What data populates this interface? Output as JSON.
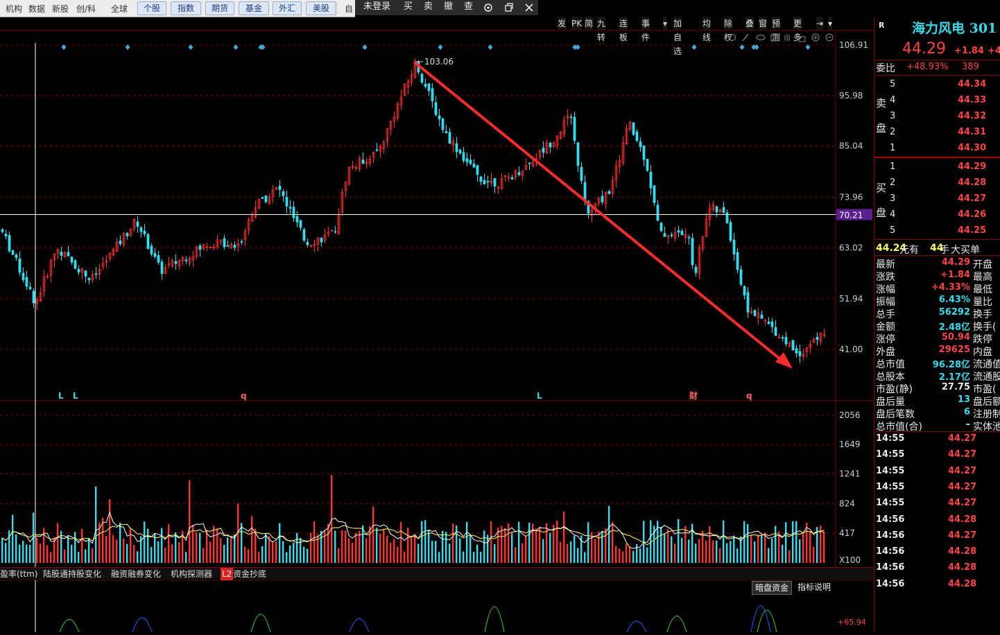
{
  "topbar": {
    "items": [
      "机构",
      "数据",
      "新股",
      "创/科",
      "全球"
    ],
    "buttons": [
      "个股",
      "指数",
      "期货",
      "基金",
      "外汇",
      "美股"
    ],
    "cut": "自"
  },
  "trade": {
    "login": "未登录",
    "buy": "买",
    "sell": "卖",
    "cancel": "撤",
    "query": "查"
  },
  "toolbar": [
    "发",
    "PK",
    "简",
    "九转",
    "连板",
    "事件",
    "加自选",
    "均线",
    "除权",
    "叠",
    "窗",
    "预测",
    "更多"
  ],
  "price_axis": [
    "106.91",
    "95.98",
    "85.04",
    "73.96",
    "70.21",
    "63.02",
    "51.94",
    "41.00"
  ],
  "peak_label": "103.06",
  "markers": [
    "L",
    "L",
    "q",
    "L",
    "财",
    "q"
  ],
  "volume_axis": [
    "2056",
    "1649",
    "1241",
    "824",
    "417",
    "X100"
  ],
  "tabs": [
    "盈率(ttm)",
    "陆股通持股变化",
    "融资融券变化",
    "机构探测器",
    "L2",
    "资金抄底"
  ],
  "indicator_buttons": [
    "暗盘资金",
    "指标说明"
  ],
  "indicator_value": "+65.94",
  "colors": {
    "up": "#ff3333",
    "down": "#33ddee",
    "arrow": "#ff2a2a",
    "grid": "#7a0000",
    "crosshair": "#ffffff",
    "label_bg": "#5a2090"
  },
  "quote": {
    "flag": "R",
    "name": "海力风电 301",
    "price": "44.29",
    "change": "+1.84",
    "pct_cut": "+4.",
    "weibi_label": "委比",
    "weibi": "+48.93%",
    "weibi_diff": "389",
    "sell_label": [
      "卖",
      "盘"
    ],
    "buy_label": [
      "买",
      "盘"
    ],
    "sell": [
      [
        "5",
        "44.34"
      ],
      [
        "4",
        "44.33"
      ],
      [
        "3",
        "44.32"
      ],
      [
        "2",
        "44.31"
      ],
      [
        "1",
        "44.30"
      ]
    ],
    "buy": [
      [
        "1",
        "44.29"
      ],
      [
        "2",
        "44.28"
      ],
      [
        "3",
        "44.27"
      ],
      [
        "4",
        "44.26"
      ],
      [
        "5",
        "44.25"
      ]
    ],
    "big_order": {
      "price": "44.24",
      "t1": "元有",
      "qty": "44",
      "t2": "手",
      "t3": "大买单"
    },
    "stats": [
      [
        "最新",
        "44.29",
        "开盘"
      ],
      [
        "涨跌",
        "+1.84",
        "最高"
      ],
      [
        "涨幅",
        "+4.33%",
        "最低"
      ],
      [
        "振幅",
        "6.43%",
        "量比"
      ],
      [
        "总手",
        "56292",
        "换手"
      ],
      [
        "金额",
        "2.48亿",
        "换手("
      ],
      [
        "涨停",
        "50.94",
        "跌停"
      ],
      [
        "外盘",
        "29625",
        "内盘"
      ],
      [
        "总市值",
        "96.28亿",
        "流通值"
      ],
      [
        "总股本",
        "2.17亿",
        "流通股"
      ],
      [
        "市盈(静)",
        "27.75",
        "市盈("
      ],
      [
        "盘后量",
        "13",
        "盘后额"
      ],
      [
        "盘后笔数",
        "6",
        "注册制"
      ],
      [
        "总市值(合)",
        "–",
        "实体池"
      ]
    ],
    "ticks": [
      [
        "14:55",
        "44.27"
      ],
      [
        "14:55",
        "44.27"
      ],
      [
        "14:55",
        "44.27"
      ],
      [
        "14:55",
        "44.27"
      ],
      [
        "14:55",
        "44.27"
      ],
      [
        "14:56",
        "44.28"
      ],
      [
        "14:56",
        "44.27"
      ],
      [
        "14:56",
        "44.28"
      ],
      [
        "14:56",
        "44.28"
      ],
      [
        "14:56",
        "44.28"
      ]
    ]
  }
}
